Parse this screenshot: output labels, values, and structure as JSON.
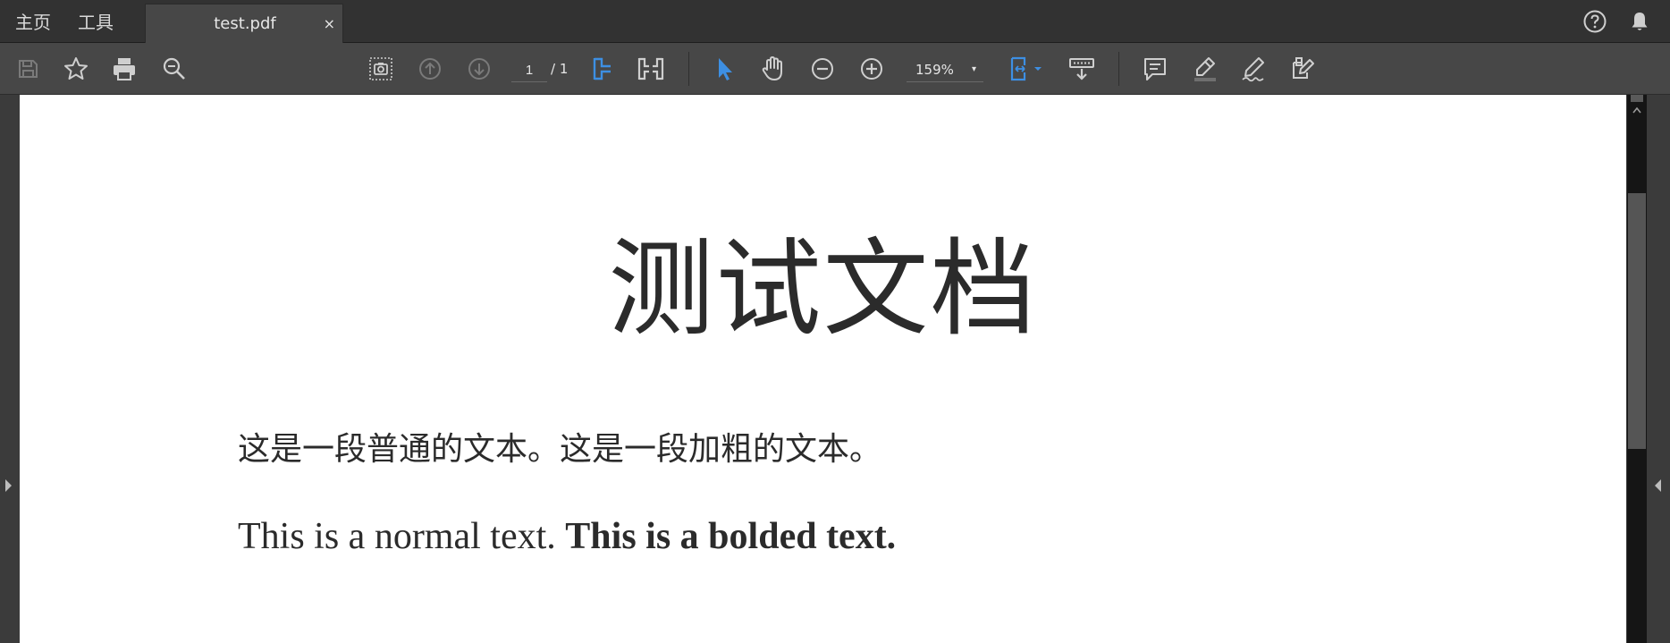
{
  "nav": {
    "home": "主页",
    "tools": "工具"
  },
  "tab": {
    "title": "test.pdf",
    "close": "×"
  },
  "toolbar": {
    "page_current": "1",
    "page_total": "/ 1",
    "zoom": "159%",
    "zoom_caret": "▾"
  },
  "icons": {
    "top_right": [
      "help-icon",
      "notification-bell-icon"
    ],
    "left_group": [
      "save-icon",
      "bookmark-star-icon",
      "print-icon",
      "search-zoom-icon"
    ],
    "nav_group": [
      "snapshot-icon",
      "previous-page-icon",
      "next-page-icon",
      "fit-width-icon",
      "two-page-icon"
    ],
    "tool_group": [
      "select-pointer-icon",
      "hand-tool-icon",
      "zoom-out-icon",
      "zoom-in-icon"
    ],
    "view_group": [
      "page-fit-icon",
      "read-mode-icon"
    ],
    "annotate_group": [
      "comment-icon",
      "highlight-icon",
      "sign-icon",
      "fill-sign-icon"
    ]
  },
  "colors": {
    "accent": "#3d8fe3",
    "toolbar": "#474747",
    "tabbar": "#323232",
    "icon": "#cfcfcf",
    "disabled": "#7a7a7a"
  },
  "document": {
    "title": "测试文档",
    "zh_paragraph": "这是一段普通的文本。这是一段加粗的文本。",
    "en_normal": "This is a normal text.",
    "en_bold": "This is a bolded text."
  }
}
